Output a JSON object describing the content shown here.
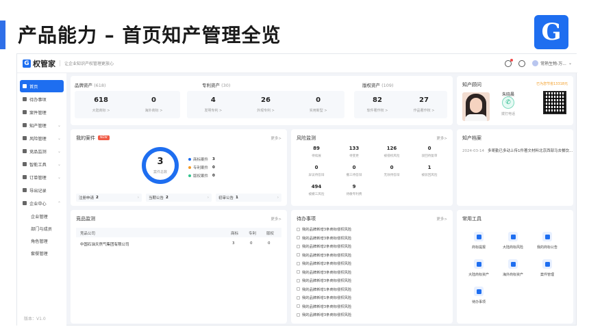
{
  "slide": {
    "title": "产品能力 – 首页知产管理全览"
  },
  "app": {
    "logo": "权管家",
    "slogan": "让企业知识产权管理更放心",
    "user": "常熟生物-万..."
  },
  "sidebar": {
    "items": [
      {
        "label": "首页",
        "icon": "home-icon",
        "active": true
      },
      {
        "label": "待办事项",
        "icon": "clock-icon"
      },
      {
        "label": "案件管理",
        "icon": "folder-icon"
      },
      {
        "label": "知产管理",
        "icon": "asset-icon",
        "chevron": "⌄"
      },
      {
        "label": "风险管理",
        "icon": "risk-icon",
        "chevron": "⌄"
      },
      {
        "label": "竞品监测",
        "icon": "monitor-icon",
        "chevron": "⌄"
      },
      {
        "label": "智能工具",
        "icon": "tool-icon",
        "chevron": "⌄"
      },
      {
        "label": "订单管理",
        "icon": "order-icon",
        "chevron": "⌄"
      },
      {
        "label": "导出记录",
        "icon": "export-icon"
      },
      {
        "label": "企业中心",
        "icon": "company-icon",
        "chevron": "⌃"
      }
    ],
    "subitems": [
      "企业管理",
      "部门与成员",
      "角色管理",
      "套餐管理"
    ],
    "version": "版本：V1.0"
  },
  "assets": {
    "brand": {
      "title": "品牌资产",
      "count": "(618)",
      "stats": [
        {
          "num": "618",
          "label": "大陆商标 >"
        },
        {
          "num": "0",
          "label": "海外商标 >"
        }
      ]
    },
    "patent": {
      "title": "专利资产",
      "count": "(30)",
      "stats": [
        {
          "num": "4",
          "label": "发明专利 >"
        },
        {
          "num": "26",
          "label": "外观专利 >"
        },
        {
          "num": "0",
          "label": "实用新型 >"
        }
      ]
    },
    "copyright": {
      "title": "版权资产",
      "count": "(109)",
      "stats": [
        {
          "num": "82",
          "label": "软件著作权 >"
        },
        {
          "num": "27",
          "label": "作品著作权 >"
        }
      ]
    }
  },
  "consultant": {
    "title": "知产顾问",
    "vip": "已为您节省13318元",
    "name": "朱晓晨",
    "call": "拨打电话"
  },
  "my_cases": {
    "title": "我的案件",
    "badge": "NEW",
    "more": "更多>",
    "total": "3",
    "total_label": "案件总数",
    "legend": [
      {
        "label": "商标案件",
        "value": "3",
        "color": "#1e6ef0"
      },
      {
        "label": "专利案件",
        "value": "0",
        "color": "#f59a23"
      },
      {
        "label": "版权案件",
        "value": "0",
        "color": "#31c48d"
      }
    ],
    "strips": [
      {
        "label": "注册申请",
        "value": "2"
      },
      {
        "label": "当期公告",
        "value": "2"
      },
      {
        "label": "初审公告",
        "value": "1"
      }
    ]
  },
  "risk": {
    "title": "风险监测",
    "more": "更多>",
    "cells": [
      {
        "num": "89",
        "label": "待续展"
      },
      {
        "num": "133",
        "label": "待变更"
      },
      {
        "num": "126",
        "label": "被侵权风险"
      },
      {
        "num": "0",
        "label": "驳回待复审"
      },
      {
        "num": "0",
        "label": "异议待答辩"
      },
      {
        "num": "0",
        "label": "撤三待答辩"
      },
      {
        "num": "0",
        "label": "无效待答辩"
      },
      {
        "num": "1",
        "label": "被驳回风险"
      },
      {
        "num": "494",
        "label": "被撤三风险"
      },
      {
        "num": "9",
        "label": "待缴专利费"
      }
    ]
  },
  "archive": {
    "title": "知产档案",
    "date": "2024-03-14",
    "text": "多哥勤已多动上传1件著文材料北京西部马去餐饮..."
  },
  "competitor": {
    "title": "竞品监测",
    "more": "更多>",
    "headers": [
      "竞品公司",
      "商标",
      "专利",
      "版权"
    ],
    "rows": [
      {
        "company": "中国石油天然气集团有限公司",
        "tm": "3",
        "pt": "0",
        "cr": "0"
      }
    ]
  },
  "todos": {
    "title": "待办事项",
    "more": "更多>",
    "items": [
      "我的品牌新增3条商标侵权风险",
      "我的品牌新增3条商标侵权风险",
      "我的品牌新增2条商标侵权风险",
      "我的品牌新增3条商标侵权风险",
      "我的品牌新增2条商标侵权风险",
      "我的品牌新增3条商标侵权风险",
      "我的品牌新增3条商标侵权风险",
      "我的品牌新增1条商标侵权风险",
      "我的品牌新增1条商标侵权风险",
      "我的品牌新增3条商标侵权风险",
      "我的品牌新增3条商标侵权风险"
    ]
  },
  "tools": {
    "title": "常用工具",
    "items": [
      "商标提报",
      "大陆商标风险",
      "我的商标公告",
      "大陆商标资产",
      "海外商标资产",
      "案件管理",
      "待办事项"
    ]
  }
}
